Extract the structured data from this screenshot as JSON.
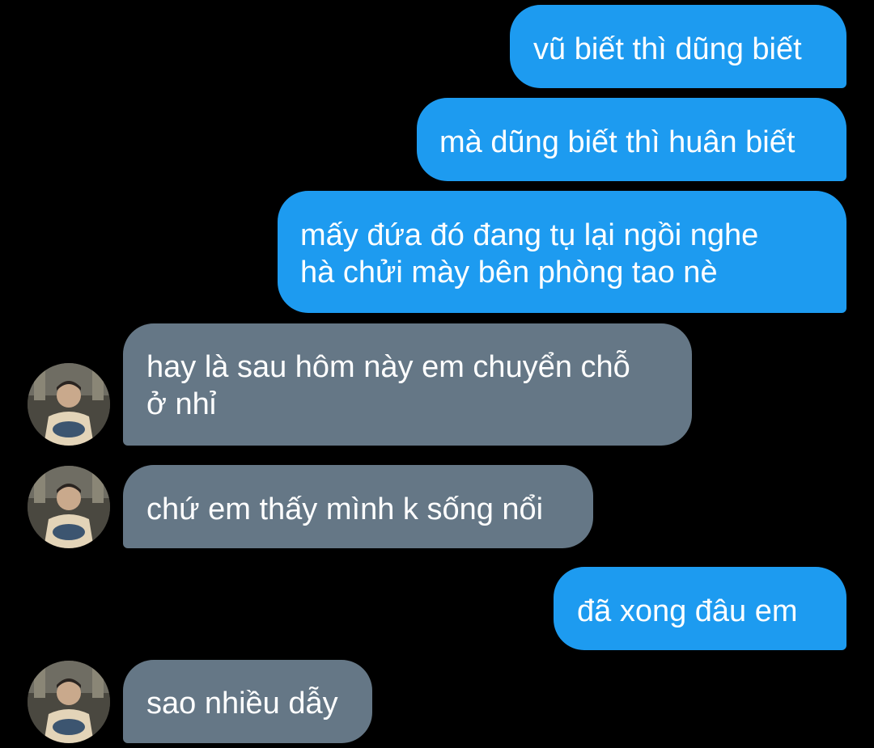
{
  "conversation": {
    "messages": [
      {
        "sender": "me",
        "lines": [
          "vũ biết thì dũng biết"
        ]
      },
      {
        "sender": "me",
        "lines": [
          "mà dũng biết thì huân biết"
        ]
      },
      {
        "sender": "me",
        "lines": [
          "mấy đứa đó đang tụ lại ngồi nghe",
          "hà chửi mày bên phòng tao nè"
        ]
      },
      {
        "sender": "them",
        "lines": [
          "hay là sau hôm này em chuyển chỗ",
          "ở nhỉ"
        ]
      },
      {
        "sender": "them",
        "lines": [
          "chứ em thấy mình k sống nổi"
        ]
      },
      {
        "sender": "me",
        "lines": [
          "đã xong đâu em"
        ]
      },
      {
        "sender": "them",
        "lines": [
          "sao nhiều dẫy"
        ]
      }
    ]
  },
  "colors": {
    "background": "#000000",
    "sent_bubble": "#1d9bf0",
    "received_bubble": "#657786",
    "text": "#ffffff"
  },
  "avatar_icon": "profile-photo-icon"
}
